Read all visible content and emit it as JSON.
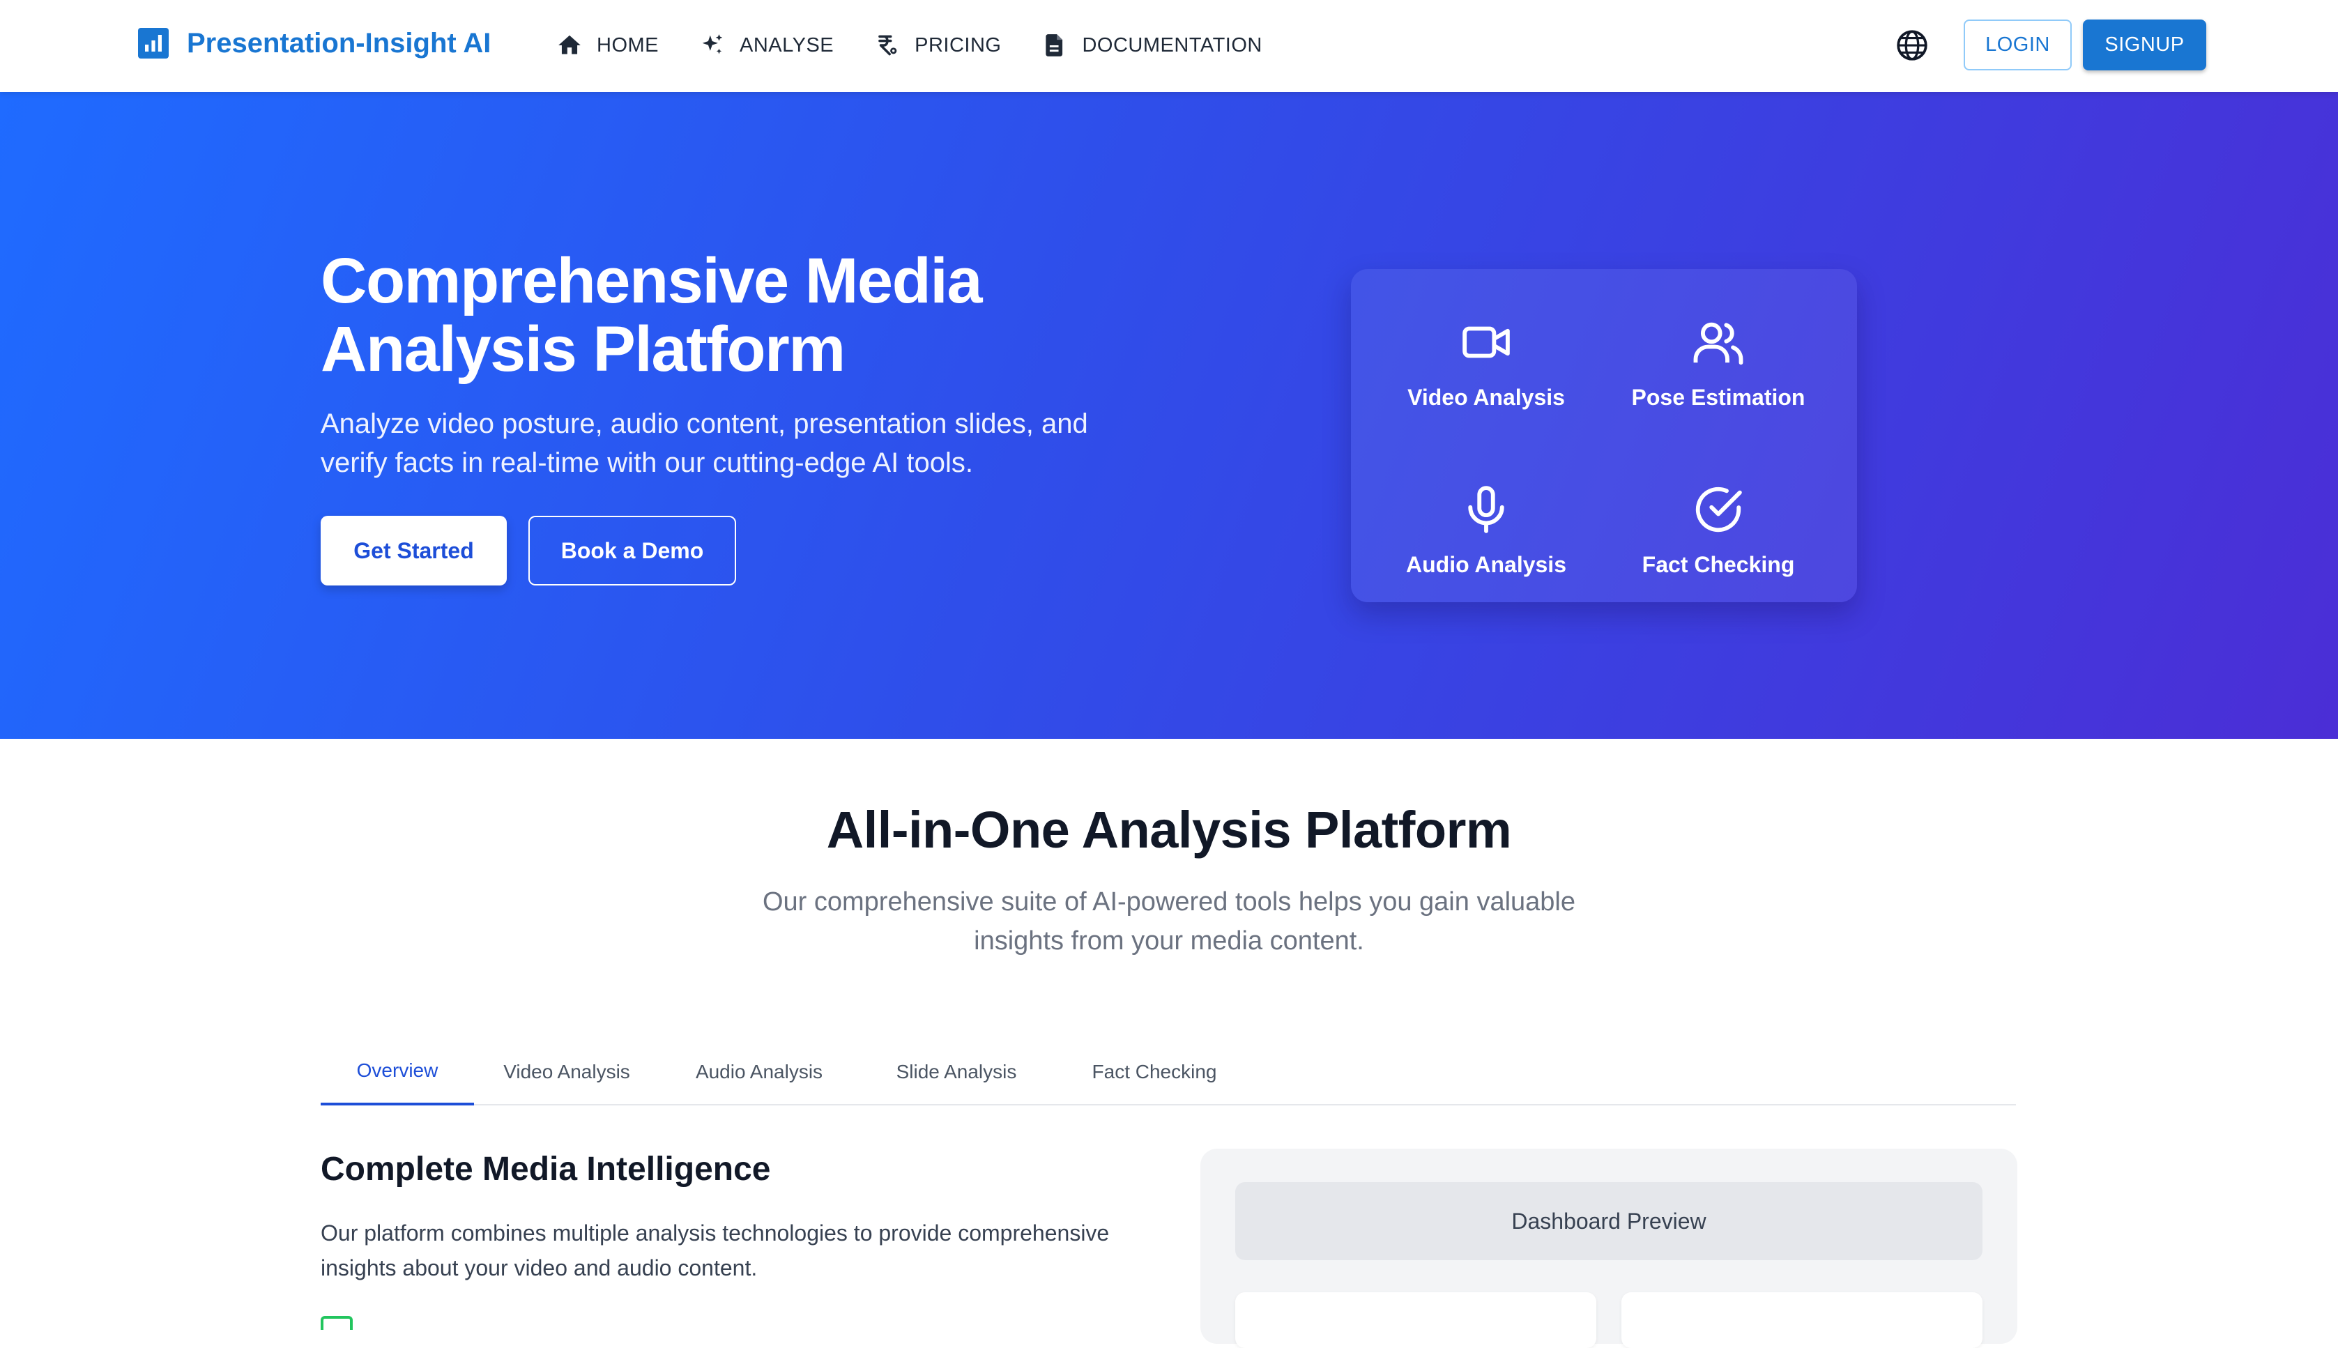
{
  "brand": {
    "name": "Presentation-Insight AI",
    "icon": "bar-chart-icon",
    "color": "#1976d2"
  },
  "nav": {
    "items": [
      {
        "label": "HOME",
        "icon": "home-icon"
      },
      {
        "label": "ANALYSE",
        "icon": "sparkle-icon"
      },
      {
        "label": "PRICING",
        "icon": "currency-icon"
      },
      {
        "label": "DOCUMENTATION",
        "icon": "document-icon"
      }
    ],
    "language_icon": "globe-icon",
    "login_label": "LOGIN",
    "signup_label": "SIGNUP"
  },
  "hero": {
    "title": "Comprehensive Media Analysis Platform",
    "subtitle": "Analyze video posture, audio content, presentation slides, and verify facts in real-time with our cutting-edge AI tools.",
    "primary_cta": "Get Started",
    "secondary_cta": "Book a Demo",
    "gradient": [
      "#1f6bff",
      "#4b2ed6"
    ],
    "features": [
      {
        "label": "Video Analysis",
        "icon": "video-camera-icon"
      },
      {
        "label": "Pose Estimation",
        "icon": "users-icon"
      },
      {
        "label": "Audio Analysis",
        "icon": "microphone-icon"
      },
      {
        "label": "Fact Checking",
        "icon": "check-circle-icon"
      }
    ]
  },
  "platform": {
    "title": "All-in-One Analysis Platform",
    "subtitle": "Our comprehensive suite of AI-powered tools helps you gain valuable insights from your media content.",
    "tabs": [
      {
        "label": "Overview",
        "active": true
      },
      {
        "label": "Video Analysis",
        "active": false
      },
      {
        "label": "Audio Analysis",
        "active": false
      },
      {
        "label": "Slide Analysis",
        "active": false
      },
      {
        "label": "Fact Checking",
        "active": false
      }
    ],
    "content_title": "Complete Media Intelligence",
    "content_text": "Our platform combines multiple analysis technologies to provide comprehensive insights about your video and audio content.",
    "dashboard_preview_label": "Dashboard Preview",
    "accent_color": "#1d4ed8"
  }
}
